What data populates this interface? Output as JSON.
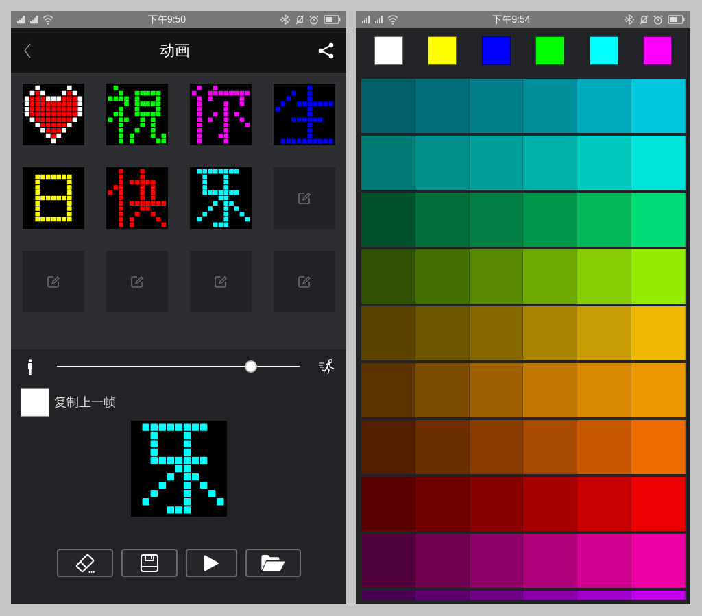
{
  "animation_screen": {
    "status_bar": {
      "time": "下午9:50"
    },
    "header": {
      "title": "动画"
    },
    "frames": [
      {
        "kind": "pixels",
        "color": "#ff0000"
      },
      {
        "kind": "pixels",
        "color": "#00ff00"
      },
      {
        "kind": "pixels",
        "color": "#ff00ff"
      },
      {
        "kind": "pixels",
        "color": "#0000ff"
      },
      {
        "kind": "pixels",
        "color": "#ffff00"
      },
      {
        "kind": "pixels",
        "color": "#ff0000"
      },
      {
        "kind": "pixels",
        "color": "#00ffff"
      },
      {
        "kind": "empty"
      },
      {
        "kind": "empty"
      },
      {
        "kind": "empty"
      },
      {
        "kind": "empty"
      },
      {
        "kind": "empty"
      }
    ],
    "speed_slider": {
      "level": 0.8
    },
    "copy_previous_frame": {
      "label": "复制上一帧",
      "checked": false
    },
    "preview": {
      "color": "#00ffff"
    },
    "toolbar": [
      {
        "kind": "erase"
      },
      {
        "kind": "save"
      },
      {
        "kind": "play"
      },
      {
        "kind": "open"
      }
    ]
  },
  "color_screen": {
    "status_bar": {
      "time": "下午9:54"
    },
    "basic_colors": [
      {
        "color": "#ffffff"
      },
      {
        "color": "#ffff00"
      },
      {
        "color": "#0000ff"
      },
      {
        "color": "#00ff00"
      },
      {
        "color": "#00ffff"
      },
      {
        "color": "#ff00ff"
      }
    ],
    "palette": {
      "rows": [
        {
          "swatches": [
            {
              "color": "#005f68"
            },
            {
              "color": "#006e78"
            },
            {
              "color": "#007f8a"
            },
            {
              "color": "#008e9a"
            },
            {
              "color": "#00aabf"
            },
            {
              "color": "#00c8dc"
            }
          ]
        },
        {
          "swatches": [
            {
              "color": "#007a75"
            },
            {
              "color": "#008e8a"
            },
            {
              "color": "#00a09a"
            },
            {
              "color": "#00b2aa"
            },
            {
              "color": "#00cbc0"
            },
            {
              "color": "#00e4dc"
            }
          ]
        },
        {
          "swatches": [
            {
              "color": "#00522a"
            },
            {
              "color": "#006f38"
            },
            {
              "color": "#008042"
            },
            {
              "color": "#00974a"
            },
            {
              "color": "#00b85a"
            },
            {
              "color": "#00dd78"
            }
          ]
        },
        {
          "swatches": [
            {
              "color": "#2f5000"
            },
            {
              "color": "#446f00"
            },
            {
              "color": "#578a00"
            },
            {
              "color": "#6fa800"
            },
            {
              "color": "#85cc00"
            },
            {
              "color": "#96ec00"
            }
          ]
        },
        {
          "swatches": [
            {
              "color": "#5a4400"
            },
            {
              "color": "#6e5500"
            },
            {
              "color": "#866800"
            },
            {
              "color": "#a88300"
            },
            {
              "color": "#c89c00"
            },
            {
              "color": "#ecb800"
            }
          ]
        },
        {
          "swatches": [
            {
              "color": "#5a3500"
            },
            {
              "color": "#7a4a00"
            },
            {
              "color": "#a06000"
            },
            {
              "color": "#c07800"
            },
            {
              "color": "#d88800"
            },
            {
              "color": "#ec9600"
            }
          ]
        },
        {
          "swatches": [
            {
              "color": "#522000"
            },
            {
              "color": "#6e2f00"
            },
            {
              "color": "#8a3c00"
            },
            {
              "color": "#a84a00"
            },
            {
              "color": "#c85800"
            },
            {
              "color": "#ec6c00"
            }
          ]
        },
        {
          "swatches": [
            {
              "color": "#5a0000"
            },
            {
              "color": "#700000"
            },
            {
              "color": "#8a0000"
            },
            {
              "color": "#a80000"
            },
            {
              "color": "#c80000"
            },
            {
              "color": "#ec0000"
            }
          ]
        },
        {
          "swatches": [
            {
              "color": "#50003a"
            },
            {
              "color": "#700050"
            },
            {
              "color": "#90006a"
            },
            {
              "color": "#b0007a"
            },
            {
              "color": "#d0008e"
            },
            {
              "color": "#ec00a4"
            }
          ]
        },
        {
          "swatches": [
            {
              "color": "#480050"
            },
            {
              "color": "#5e0070"
            },
            {
              "color": "#700088"
            },
            {
              "color": "#8a00a8"
            },
            {
              "color": "#a000c8"
            },
            {
              "color": "#c000e8"
            }
          ]
        }
      ]
    }
  }
}
